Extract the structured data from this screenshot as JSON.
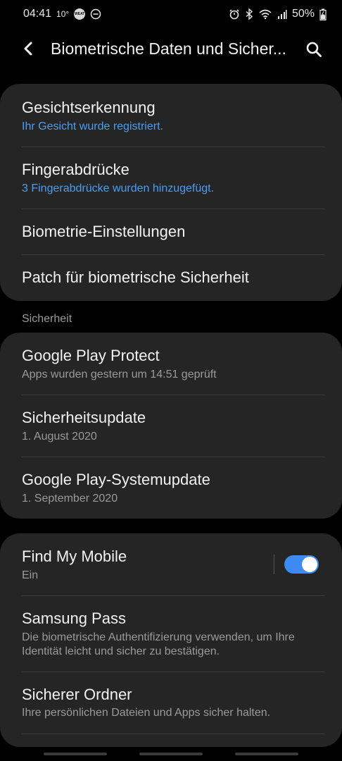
{
  "status_bar": {
    "time": "04:41",
    "temperature": "10°",
    "badge_text": "WEAT",
    "battery": "50%",
    "icons": [
      "alarm-icon",
      "bluetooth-icon",
      "wifi-icon",
      "signal-icon",
      "battery-icon"
    ]
  },
  "header": {
    "title": "Biometrische Daten und Sicher...",
    "back_icon": "back-arrow-icon",
    "search_icon": "search-icon"
  },
  "biometrics": {
    "items": [
      {
        "title": "Gesichtserkennung",
        "subtitle": "Ihr Gesicht wurde registriert."
      },
      {
        "title": "Fingerabdrücke",
        "subtitle": "3 Fingerabdrücke wurden hinzugefügt."
      },
      {
        "title": "Biometrie-Einstellungen"
      },
      {
        "title": "Patch für biometrische Sicherheit"
      }
    ]
  },
  "security": {
    "header": "Sicherheit",
    "items": [
      {
        "title": "Google Play Protect",
        "subtitle": "Apps wurden gestern um 14:51 geprüft"
      },
      {
        "title": "Sicherheitsupdate",
        "subtitle": "1. August 2020"
      },
      {
        "title": "Google Play-Systemupdate",
        "subtitle": "1. September 2020"
      }
    ]
  },
  "samsung": {
    "items": [
      {
        "title": "Find My Mobile",
        "subtitle": "Ein",
        "toggle_on": true
      },
      {
        "title": "Samsung Pass",
        "subtitle": "Die biometrische Authentifizierung verwenden, um Ihre Identität leicht und sicher zu bestätigen."
      },
      {
        "title": "Sicherer Ordner",
        "subtitle": "Ihre persönlichen Dateien und Apps sicher halten."
      }
    ]
  },
  "colors": {
    "background": "#000000",
    "card": "#252525",
    "accent_blue": "#4a9ef2",
    "toggle_on": "#3e8af3",
    "secondary_text": "#9a9a9a"
  }
}
